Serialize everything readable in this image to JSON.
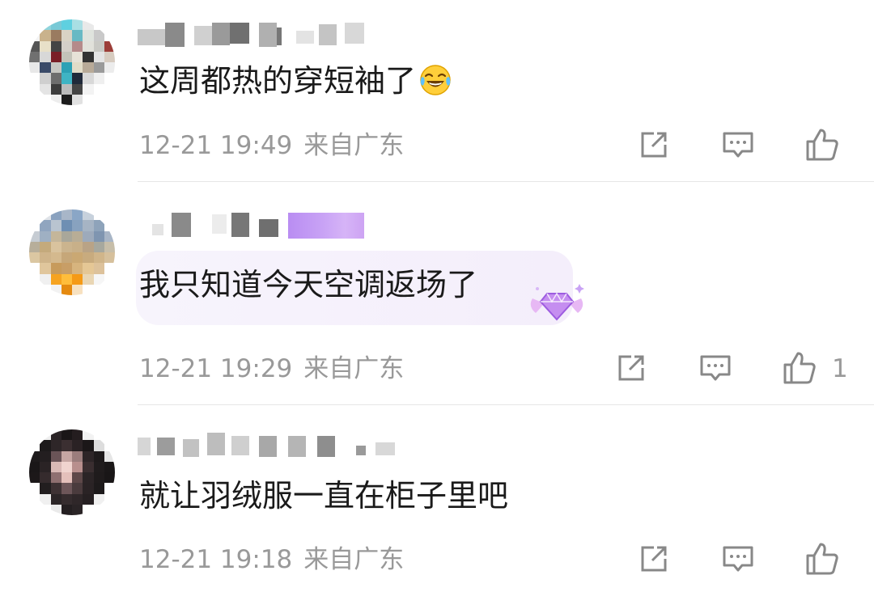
{
  "comments": [
    {
      "text": "这周都热的穿短袖了",
      "emoji": "laughing-tears-emoji",
      "time": "12-21 19:49",
      "location": "来自广东",
      "likes": ""
    },
    {
      "text": "我只知道今天空调返场了",
      "emoji": "",
      "time": "12-21 19:29",
      "location": "来自广东",
      "likes": "1"
    },
    {
      "text": "就让羽绒服一直在柜子里吧",
      "emoji": "",
      "time": "12-21 19:18",
      "location": "来自广东",
      "likes": ""
    }
  ],
  "icons": {
    "share": "share-icon",
    "reply": "comment-icon",
    "like": "thumbs-up-icon",
    "badge": "diamond-badge-icon"
  },
  "colors": {
    "text": "#1a1a1a",
    "meta": "#999999",
    "icon": "#888888",
    "vip_badge": "#b57bee"
  }
}
